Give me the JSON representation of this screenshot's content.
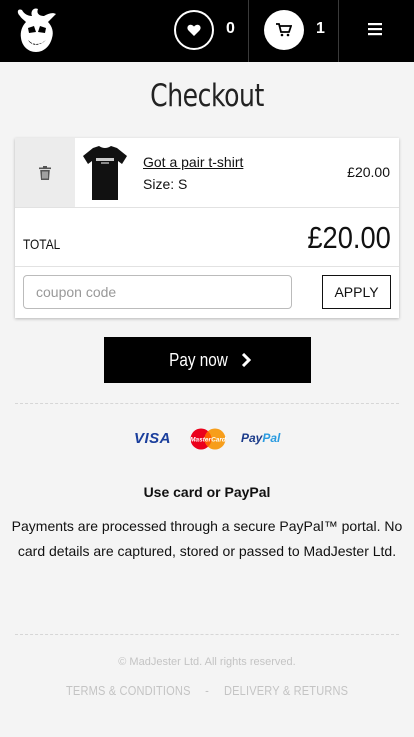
{
  "header": {
    "wishlist_count": "0",
    "cart_count": "1"
  },
  "page": {
    "title": "Checkout"
  },
  "cart": {
    "items": [
      {
        "name": "Got a pair t-shirt",
        "size": "Size: S",
        "price": "£20.00"
      }
    ],
    "total_label": "TOTAL",
    "total_value": "£20.00",
    "coupon_placeholder": "coupon code",
    "apply_label": "APPLY"
  },
  "actions": {
    "pay_label": "Pay now"
  },
  "payment": {
    "visa": "VISA",
    "mastercard": "MasterCard",
    "paypal_part1": "Pay",
    "paypal_part2": "Pal",
    "subtitle": "Use card or PayPal",
    "description": "Payments are processed through a secure PayPal™ portal. No card details are captured, stored or passed to MadJester Ltd."
  },
  "footer": {
    "copyright": "© MadJester Ltd. All rights reserved.",
    "terms": "TERMS & CONDITIONS",
    "separator": " - ",
    "delivery": "DELIVERY & RETURNS"
  },
  "colors": {
    "header_bg": "#000000",
    "page_bg": "#f4f4f4",
    "visa_blue": "#1a3e9c",
    "paypal_dark": "#1b3b8a",
    "paypal_light": "#2a9be0",
    "mastercard_red": "#eb001b",
    "mastercard_orange": "#f79e1b"
  },
  "icons": {
    "logo": "jester-logo-icon",
    "wishlist": "heart-icon",
    "cart": "cart-icon",
    "menu": "hamburger-icon",
    "delete": "trash-icon",
    "pay_arrow": "chevron-right-icon"
  }
}
